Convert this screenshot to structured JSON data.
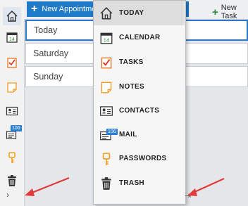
{
  "toolbar": {
    "new_appointment_label": "New Appointment",
    "new_task_label": "New Task"
  },
  "days": [
    {
      "label": "Today"
    },
    {
      "label": "Saturday"
    },
    {
      "label": "Sunday"
    }
  ],
  "sidebar": {
    "icons": [
      "home-icon",
      "calendar-icon",
      "tasks-icon",
      "notes-icon",
      "contacts-icon",
      "mail-icon",
      "passwords-icon",
      "trash-icon"
    ],
    "calendar_date": "14",
    "mail_badge": "106",
    "expand_label": "›"
  },
  "menu": {
    "items": [
      {
        "label": "TODAY",
        "icon": "home-icon"
      },
      {
        "label": "CALENDAR",
        "icon": "calendar-icon"
      },
      {
        "label": "TASKS",
        "icon": "tasks-icon"
      },
      {
        "label": "NOTES",
        "icon": "notes-icon"
      },
      {
        "label": "CONTACTS",
        "icon": "contacts-icon"
      },
      {
        "label": "MAIL",
        "icon": "mail-icon"
      },
      {
        "label": "PASSWORDS",
        "icon": "passwords-icon"
      },
      {
        "label": "TRASH",
        "icon": "trash-icon"
      }
    ],
    "calendar_date": "14",
    "mail_badge": "106",
    "pin_label": "⇥"
  },
  "colors": {
    "accent": "#1f7ac8",
    "annotation_arrow": "#e03a3a",
    "tasks_orange": "#e8741c",
    "notes_orange": "#f39a1e",
    "password_key": "#f0a020"
  }
}
